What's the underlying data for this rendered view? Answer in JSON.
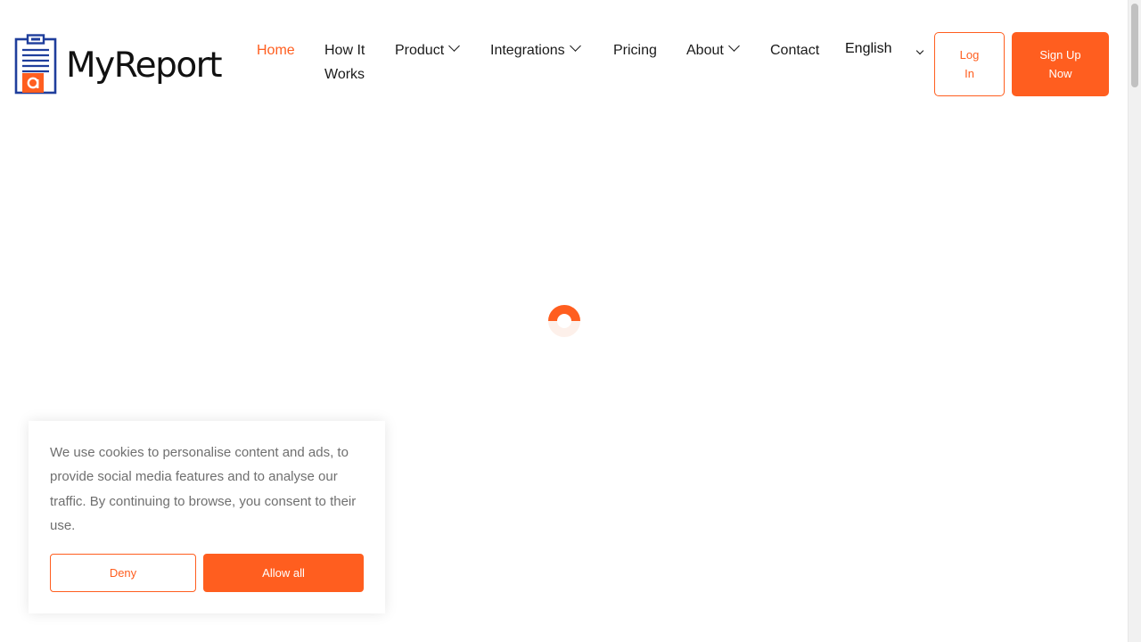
{
  "header": {
    "logo_text": "MyReport",
    "nav": {
      "home": "Home",
      "how_it_works_line1": "How It",
      "how_it_works_line2": "Works",
      "product": "Product",
      "integrations": "Integrations",
      "pricing": "Pricing",
      "about": "About",
      "contact": "Contact"
    },
    "language": "English",
    "login_label": "Log In",
    "signup_label": "Sign Up Now"
  },
  "cookie_banner": {
    "text": "We use cookies to personalise content and ads, to provide social media features and to analyse our traffic. By continuing to browse, you consent to their use.",
    "deny_label": "Deny",
    "allow_label": "Allow all"
  },
  "colors": {
    "accent": "#ff5e1f",
    "logo_blue": "#1f3e9c"
  }
}
